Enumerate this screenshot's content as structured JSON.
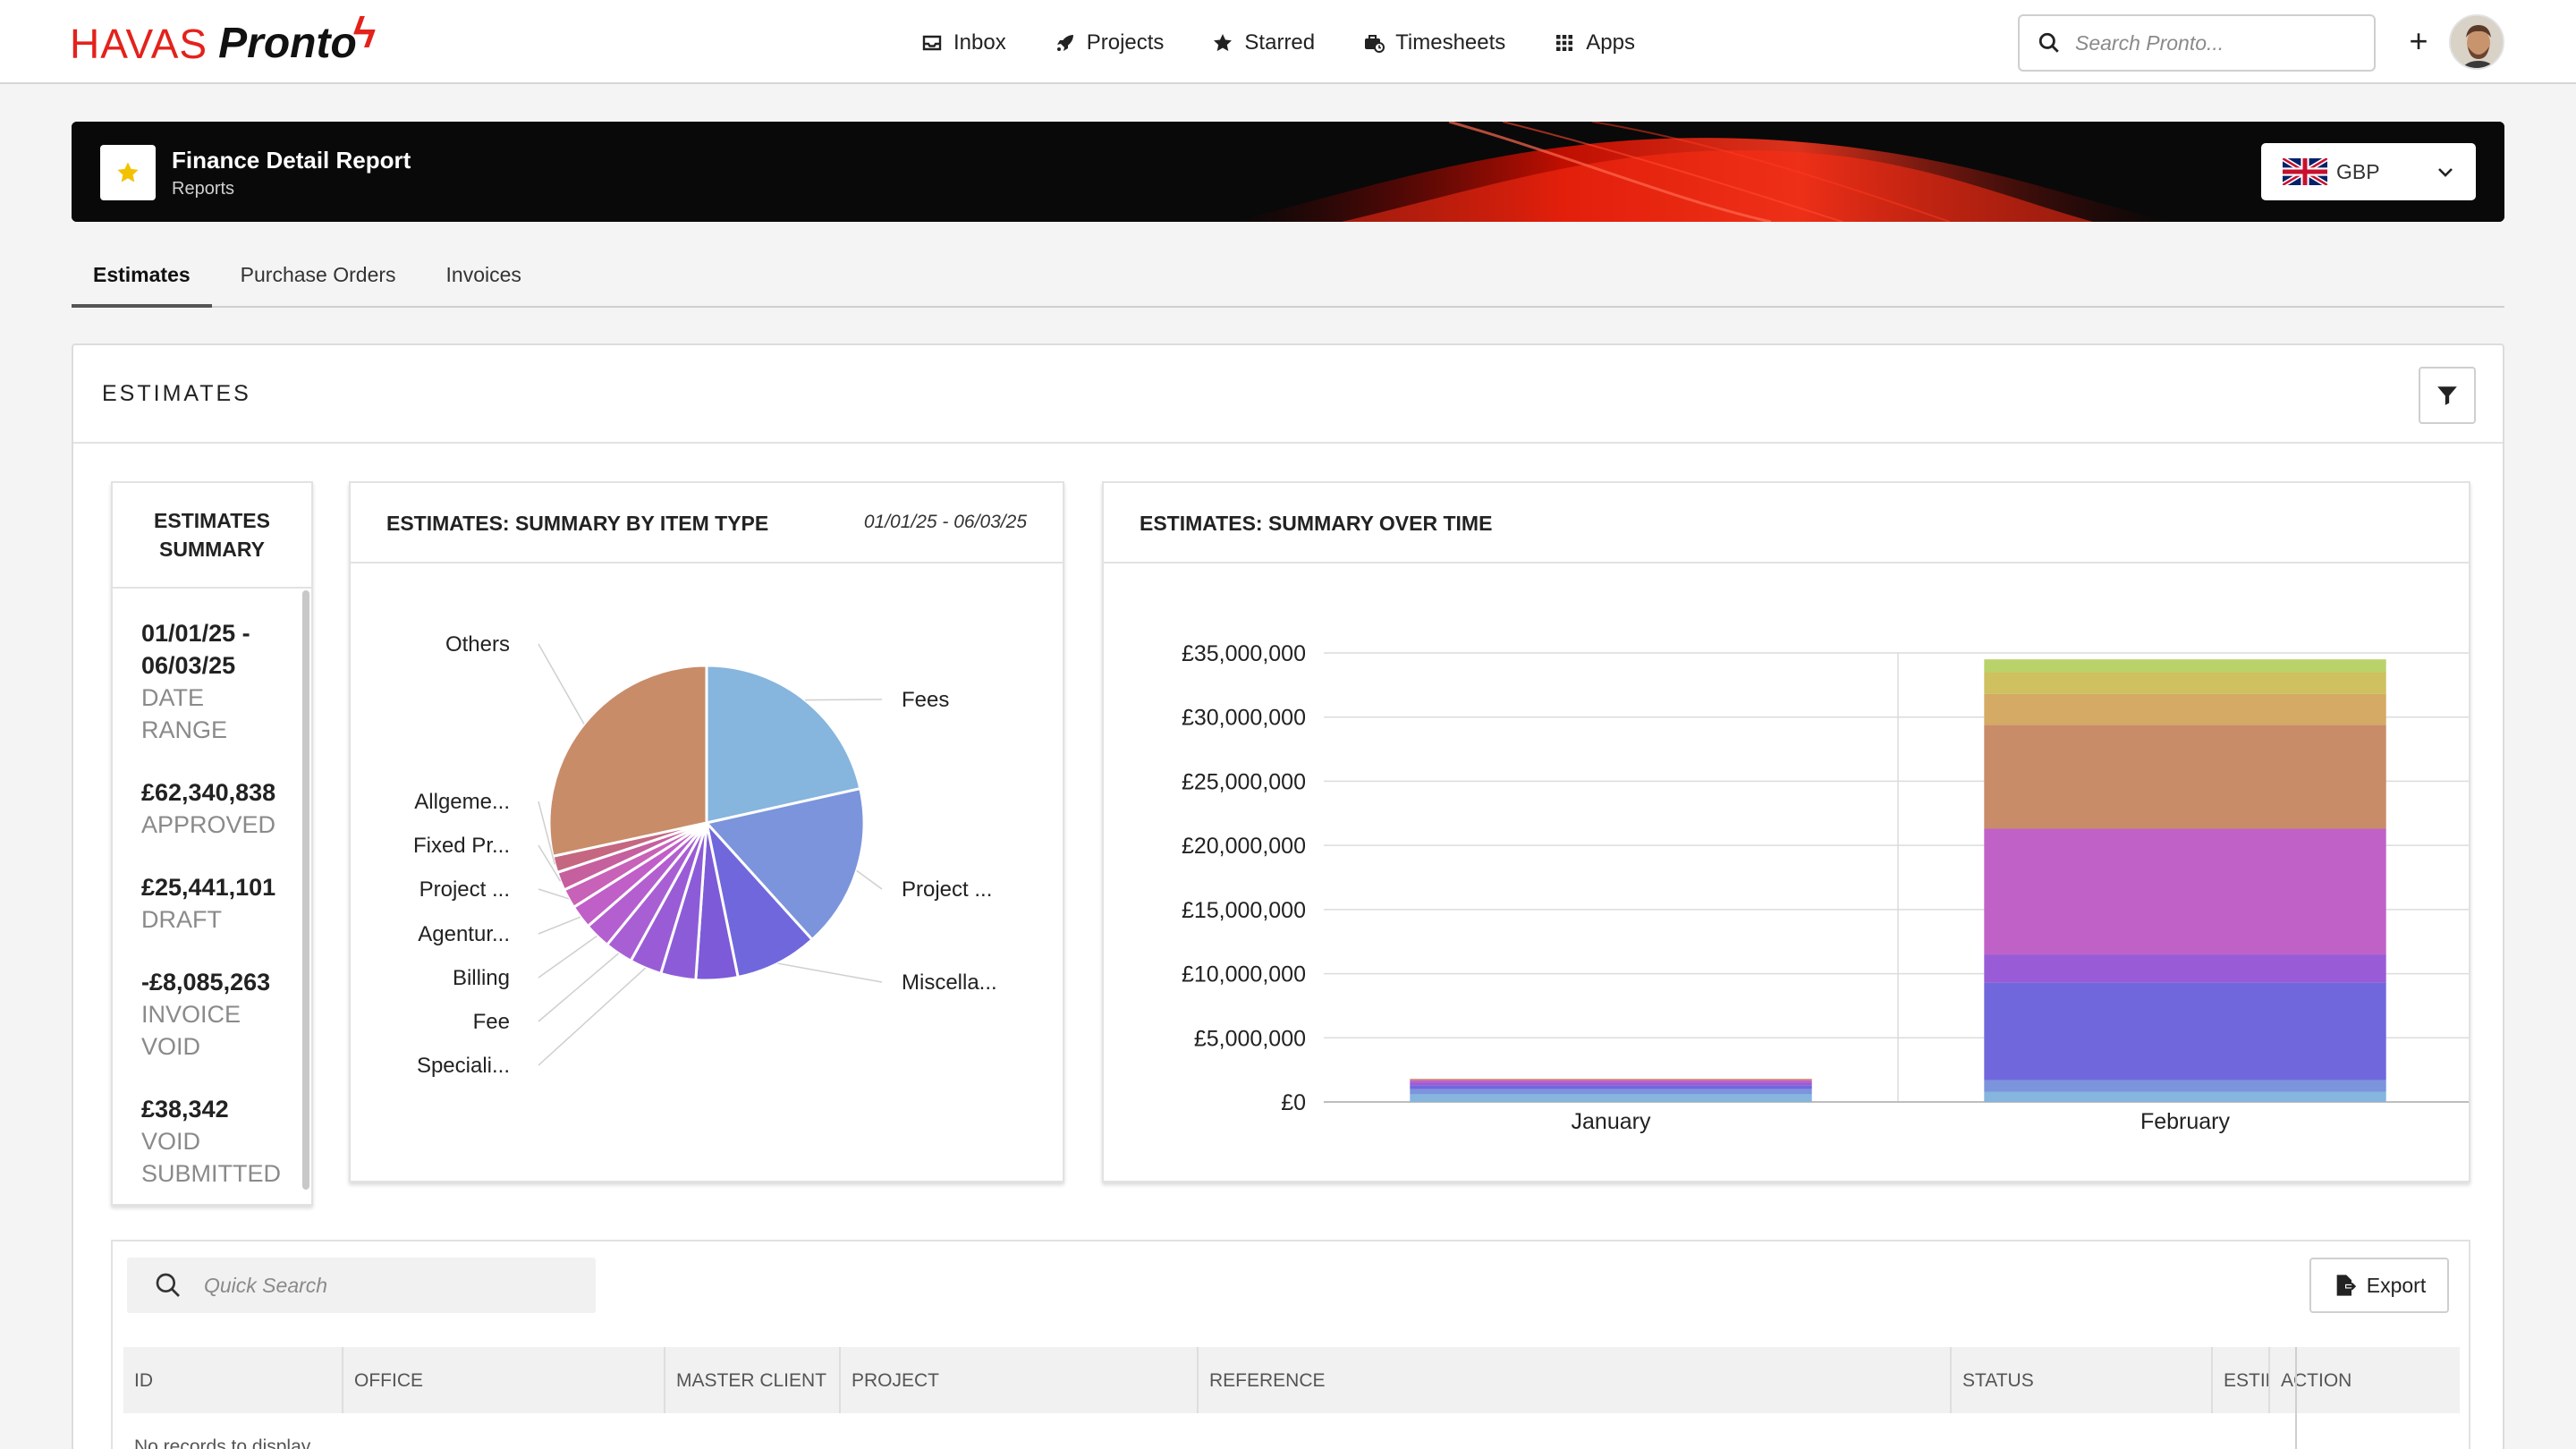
{
  "header": {
    "logo_brand": "HAVAS",
    "logo_product": "Pronto",
    "nav": [
      {
        "label": "Inbox",
        "icon": "inbox-icon"
      },
      {
        "label": "Projects",
        "icon": "rocket-icon"
      },
      {
        "label": "Starred",
        "icon": "star-icon"
      },
      {
        "label": "Timesheets",
        "icon": "briefcase-clock-icon"
      },
      {
        "label": "Apps",
        "icon": "grid-icon"
      }
    ],
    "search_placeholder": "Search Pronto...",
    "add_label": "+"
  },
  "banner": {
    "title": "Finance Detail Report",
    "subtitle": "Reports",
    "currency": "GBP"
  },
  "tabs": [
    {
      "label": "Estimates",
      "active": true
    },
    {
      "label": "Purchase Orders",
      "active": false
    },
    {
      "label": "Invoices",
      "active": false
    }
  ],
  "panel": {
    "title": "ESTIMATES"
  },
  "summary": {
    "title": "ESTIMATES SUMMARY",
    "stats": [
      {
        "value": "01/01/25 - 06/03/25",
        "label": "DATE RANGE"
      },
      {
        "value": "£62,340,838",
        "label": "APPROVED"
      },
      {
        "value": "£25,441,101",
        "label": "DRAFT"
      },
      {
        "value": "-£8,085,263",
        "label": "INVOICE VOID"
      },
      {
        "value": "£38,342",
        "label": "VOID SUBMITTED"
      }
    ]
  },
  "pie_card": {
    "title": "ESTIMATES: SUMMARY BY ITEM TYPE",
    "date_range": "01/01/25 - 06/03/25"
  },
  "bar_card": {
    "title": "ESTIMATES: SUMMARY OVER TIME"
  },
  "colors": {
    "brand_red": "#e3221b",
    "accent_star": "#f2c200"
  },
  "chart_data": [
    {
      "type": "pie",
      "title": "ESTIMATES: SUMMARY BY ITEM TYPE",
      "slices": [
        {
          "label": "Fees",
          "value": 21.5,
          "color": "#86b5de"
        },
        {
          "label": "Project ...",
          "value": 16.8,
          "color": "#7b94dc"
        },
        {
          "label": "Miscella...",
          "value": 8.5,
          "color": "#7167dc"
        },
        {
          "label": "",
          "value": 4.3,
          "color": "#7c5ad8"
        },
        {
          "label": "",
          "value": 3.6,
          "color": "#8c5cd8"
        },
        {
          "label": "Speciali...",
          "value": 3.3,
          "color": "#9a5cd6"
        },
        {
          "label": "Fee",
          "value": 2.9,
          "color": "#a85fd4"
        },
        {
          "label": "Billing",
          "value": 2.7,
          "color": "#b45fd0"
        },
        {
          "label": "Agentur...",
          "value": 2.4,
          "color": "#c05fc8"
        },
        {
          "label": "Project ...",
          "value": 2.0,
          "color": "#c861b8"
        },
        {
          "label": "Fixed Pr...",
          "value": 1.9,
          "color": "#c65f9e"
        },
        {
          "label": "Allgeme...",
          "value": 1.7,
          "color": "#c56780"
        },
        {
          "label": "Others",
          "value": 28.4,
          "color": "#c98c68"
        }
      ]
    },
    {
      "type": "bar",
      "title": "ESTIMATES: SUMMARY OVER TIME",
      "categories": [
        "January",
        "February"
      ],
      "y_ticks": [
        "£0",
        "£5,000,000",
        "£10,000,000",
        "£15,000,000",
        "£20,000,000",
        "£25,000,000",
        "£30,000,000",
        "£35,000,000"
      ],
      "ylim": [
        0,
        35000000
      ],
      "stacked": true,
      "series": [
        {
          "values": [
            600000,
            800000
          ],
          "color": "#86b5de"
        },
        {
          "values": [
            400000,
            900000
          ],
          "color": "#7b94dc"
        },
        {
          "values": [
            300000,
            7600000
          ],
          "color": "#7167dc"
        },
        {
          "values": [
            200000,
            2200000
          ],
          "color": "#9a5cd6"
        },
        {
          "values": [
            200000,
            9800000
          ],
          "color": "#c061c8"
        },
        {
          "values": [
            100000,
            8100000
          ],
          "color": "#c98c68"
        },
        {
          "values": [
            0,
            2400000
          ],
          "color": "#d4aa64"
        },
        {
          "values": [
            0,
            1700000
          ],
          "color": "#cfc060"
        },
        {
          "values": [
            0,
            1000000
          ],
          "color": "#b9d36a"
        }
      ],
      "grid": true
    }
  ],
  "table": {
    "search_placeholder": "Quick Search",
    "export_label": "Export",
    "columns": [
      "ID",
      "OFFICE",
      "MASTER CLIENT",
      "PROJECT",
      "REFERENCE",
      "STATUS",
      "ESTIMATE",
      "ACTION"
    ],
    "empty_text": "No records to display"
  }
}
